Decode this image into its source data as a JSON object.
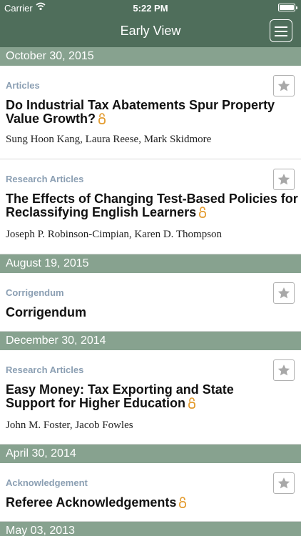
{
  "status_bar": {
    "carrier": "Carrier",
    "time": "5:22 PM"
  },
  "nav": {
    "title": "Early View",
    "menu_icon": "hamburger-menu-icon"
  },
  "sections": [
    {
      "date": "October 30, 2015",
      "articles": [
        {
          "category": "Articles",
          "title": "Do Industrial Tax Abatements Spur Property Value Growth?",
          "authors": "Sung Hoon Kang, Laura Reese, Mark Skidmore",
          "open_access": true
        },
        {
          "category": "Research Articles",
          "title": "The Effects of Changing Test-Based Policies for Reclassifying English Learners",
          "authors": "Joseph P. Robinson-Cimpian, Karen D. Thompson",
          "open_access": true
        }
      ]
    },
    {
      "date": "August 19, 2015",
      "articles": [
        {
          "category": "Corrigendum",
          "title": "Corrigendum",
          "authors": "",
          "open_access": false
        }
      ]
    },
    {
      "date": "December 30, 2014",
      "articles": [
        {
          "category": "Research Articles",
          "title": "Easy Money: Tax Exporting and State Support for Higher Education",
          "authors": "John M. Foster, Jacob Fowles",
          "open_access": true
        }
      ]
    },
    {
      "date": "April 30, 2014",
      "articles": [
        {
          "category": "Acknowledgement",
          "title": "Referee Acknowledgements",
          "authors": "",
          "open_access": true
        }
      ]
    },
    {
      "date": "May 03, 2013",
      "articles": []
    }
  ],
  "colors": {
    "header": "#4f6e5b",
    "section_bar": "#87a28f",
    "category_text": "#8b9fb3",
    "open_access": "#e39a2c"
  }
}
